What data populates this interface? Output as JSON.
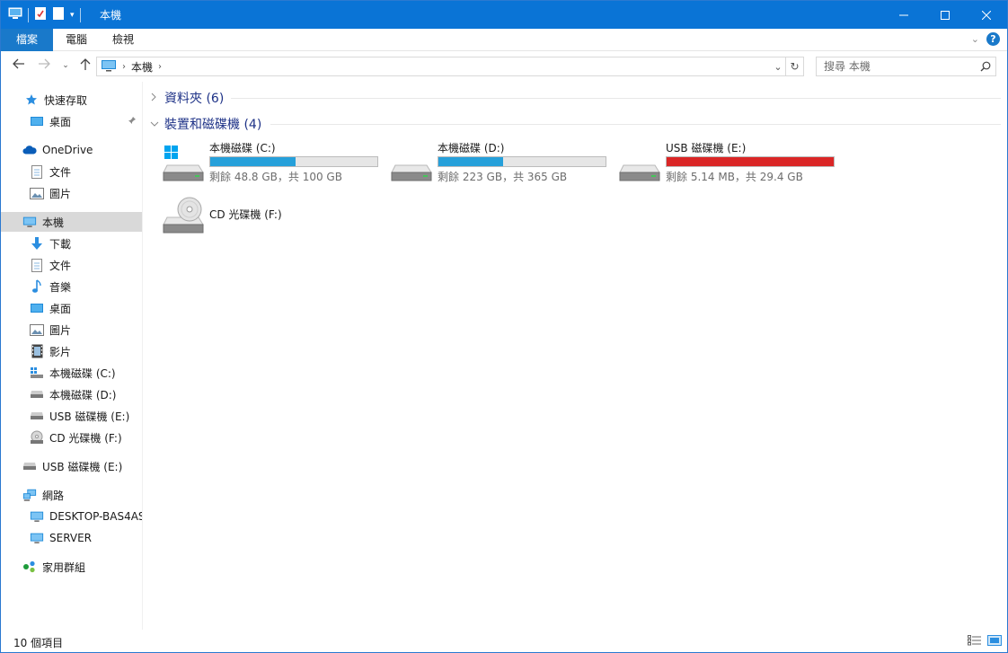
{
  "window": {
    "title": "本機"
  },
  "ribbon": {
    "tabs": [
      "檔案",
      "電腦",
      "檢視"
    ],
    "help": "?"
  },
  "address": {
    "crumb": "本機"
  },
  "search": {
    "placeholder": "搜尋 本機"
  },
  "sidebar": {
    "quick_access": "快速存取",
    "desktop_pinned": "桌面",
    "onedrive": "OneDrive",
    "od_documents": "文件",
    "od_pictures": "圖片",
    "this_pc": "本機",
    "downloads": "下載",
    "documents": "文件",
    "music": "音樂",
    "desktop": "桌面",
    "pictures": "圖片",
    "videos": "影片",
    "drive_c": "本機磁碟 (C:)",
    "drive_d": "本機磁碟 (D:)",
    "drive_e": "USB 磁碟機 (E:)",
    "drive_f": "CD 光碟機 (F:)",
    "usb_root": "USB 磁碟機 (E:)",
    "network": "網路",
    "net_desktop": "DESKTOP-BAS4AS",
    "net_server": "SERVER",
    "homegroup": "家用群組"
  },
  "groups": {
    "folders": "資料夾 (6)",
    "devices": "裝置和磁碟機 (4)"
  },
  "drives": [
    {
      "name": "本機磁碟 (C:)",
      "info": "剩餘 48.8 GB，共 100 GB",
      "used_fraction": 0.512
    },
    {
      "name": "本機磁碟 (D:)",
      "info": "剩餘 223 GB，共 365 GB",
      "used_fraction": 0.389
    },
    {
      "name": "USB 磁碟機 (E:)",
      "info": "剩餘 5.14 MB，共 29.4 GB",
      "used_fraction": 0.999
    },
    {
      "name": "CD 光碟機 (F:)"
    }
  ],
  "colors": {
    "titlebar": "#0a74d6",
    "bar_normal": "#26a0da",
    "bar_full": "#da2626"
  },
  "status": {
    "count": "10 個項目"
  }
}
